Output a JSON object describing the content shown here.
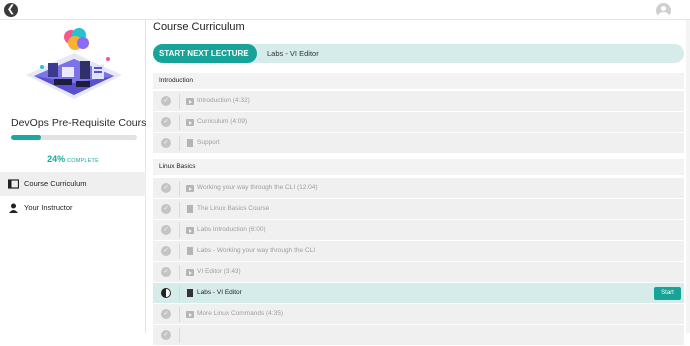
{
  "topbar": {
    "back_icon": "back-arrow-icon",
    "avatar_icon": "user-avatar-icon"
  },
  "sidebar": {
    "course_title": "DevOps Pre-Requisite Course",
    "progress_value": 24,
    "progress_percent": "24%",
    "progress_label": "COMPLETE",
    "nav": [
      {
        "label": "Course Curriculum",
        "icon": "book-icon",
        "active": true
      },
      {
        "label": "Your Instructor",
        "icon": "person-icon",
        "active": false
      }
    ]
  },
  "main": {
    "title": "Course Curriculum",
    "next_button_label": "START NEXT LECTURE",
    "next_lecture_name": "Labs - VI Editor",
    "sections": [
      {
        "name": "Introduction",
        "lectures": [
          {
            "title": "Introduction (4:32)",
            "type": "video",
            "status": "done"
          },
          {
            "title": "Curriculum (4:09)",
            "type": "video",
            "status": "done"
          },
          {
            "title": "Support",
            "type": "doc",
            "status": "done"
          }
        ]
      },
      {
        "name": "Linux Basics",
        "lectures": [
          {
            "title": "Working your way through the CLI (12:04)",
            "type": "video",
            "status": "done"
          },
          {
            "title": "The Linux Basics Course",
            "type": "doc",
            "status": "done"
          },
          {
            "title": "Labs Introduction (6:00)",
            "type": "video",
            "status": "done"
          },
          {
            "title": "Labs - Working your way through the CLI",
            "type": "doc",
            "status": "done"
          },
          {
            "title": "VI Editor (3:43)",
            "type": "video",
            "status": "done"
          },
          {
            "title": "Labs - VI Editor",
            "type": "doc",
            "status": "current",
            "action": "Start"
          },
          {
            "title": "More Linux Commands (4:35)",
            "type": "video",
            "status": "done"
          }
        ]
      }
    ]
  },
  "colors": {
    "accent": "#17a398",
    "accent_light": "#d5ecea"
  }
}
